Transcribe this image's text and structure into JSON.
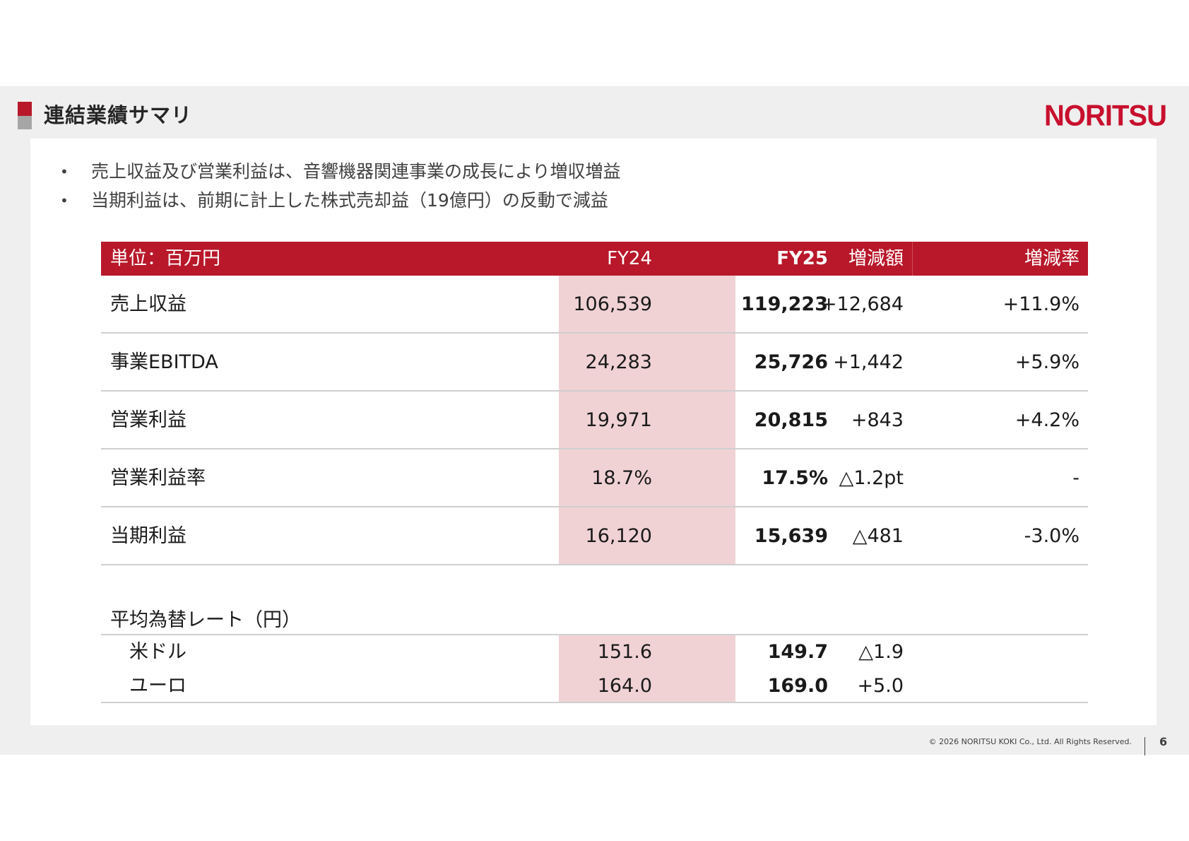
{
  "header": {
    "title": "連結業績サマリ",
    "logo": "NORITSU"
  },
  "bullets": [
    "売上収益及び営業利益は、音響機器関連事業の成長により増収増益",
    "当期利益は、前期に計上した株式売却益（19億円）の反動で減益"
  ],
  "table": {
    "headers": {
      "unit": "単位：百万円",
      "fy24": "FY24",
      "fy25": "FY25",
      "diff": "増減額",
      "rate": "増減率"
    },
    "rows": [
      {
        "label": "売上収益",
        "fy24": "106,539",
        "fy25": "119,223",
        "diff": "+12,684",
        "rate": "+11.9%"
      },
      {
        "label": "事業EBITDA",
        "fy24": "24,283",
        "fy25": "25,726",
        "diff": "+1,442",
        "rate": "+5.9%"
      },
      {
        "label": "営業利益",
        "fy24": "19,971",
        "fy25": "20,815",
        "diff": "+843",
        "rate": "+4.2%"
      },
      {
        "label": "営業利益率",
        "fy24": "18.7%",
        "fy25": "17.5%",
        "diff": "△1.2pt",
        "rate": "-"
      },
      {
        "label": "当期利益",
        "fy24": "16,120",
        "fy25": "15,639",
        "diff": "△481",
        "rate": "-3.0%"
      }
    ]
  },
  "fx": {
    "title": "平均為替レート（円）",
    "rows": [
      {
        "label": "米ドル",
        "fy24": "151.6",
        "fy25": "149.7",
        "diff": "△1.9"
      },
      {
        "label": "ユーロ",
        "fy24": "164.0",
        "fy25": "169.0",
        "diff": "+5.0"
      }
    ]
  },
  "footer": {
    "copyright": "© 2026 NORITSU KOKI Co., Ltd. All Rights Reserved.",
    "page": "6"
  },
  "colors": {
    "brand_red": "#b8182a",
    "highlight": "#f0d2d5",
    "logo_red": "#c8102e"
  }
}
